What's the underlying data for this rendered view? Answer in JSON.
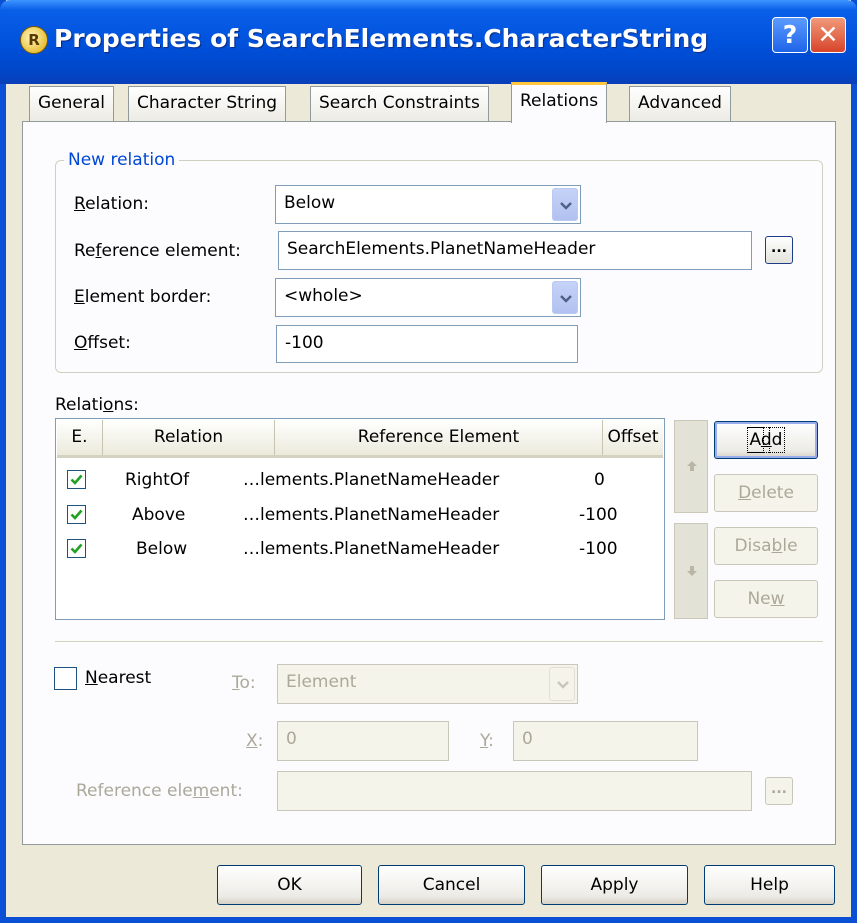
{
  "window": {
    "title": "Properties of SearchElements.CharacterString",
    "help_glyph": "?",
    "close_glyph": "✕",
    "app_icon_glyph": "R"
  },
  "tabs": [
    {
      "label": "General",
      "active": false
    },
    {
      "label": "Character String",
      "active": false
    },
    {
      "label": "Search Constraints",
      "active": false
    },
    {
      "label": "Relations",
      "active": true
    },
    {
      "label": "Advanced",
      "active": false
    }
  ],
  "new_relation": {
    "legend": "New relation",
    "relation_label_pre": "",
    "relation_label_mn": "R",
    "relation_label_post": "elation:",
    "relation_value": "Below",
    "reference_label_pre": "Re",
    "reference_label_mn": "f",
    "reference_label_post": "erence element:",
    "reference_value": "SearchElements.PlanetNameHeader",
    "reference_browse": "...",
    "border_label_pre": "",
    "border_label_mn": "E",
    "border_label_post": "lement border:",
    "border_value": "<whole>",
    "offset_label_pre": "",
    "offset_label_mn": "O",
    "offset_label_post": "ffset:",
    "offset_value": "-100"
  },
  "relations_list": {
    "label_pre": "Relati",
    "label_mn": "o",
    "label_post": "ns:",
    "columns": [
      "E.",
      "Relation",
      "Reference Element",
      "Offset"
    ],
    "rows": [
      {
        "enabled": true,
        "relation": "RightOf",
        "reference": "…lements.PlanetNameHeader",
        "offset": "0"
      },
      {
        "enabled": true,
        "relation": "Above",
        "reference": "…lements.PlanetNameHeader",
        "offset": "-100"
      },
      {
        "enabled": true,
        "relation": "Below",
        "reference": "…lements.PlanetNameHeader",
        "offset": "-100"
      }
    ]
  },
  "list_buttons": {
    "add_pre": "A",
    "add_mn": "d",
    "add_post": "d",
    "delete_pre": "",
    "delete_mn": "D",
    "delete_post": "elete",
    "disable_pre": "Disa",
    "disable_mn": "b",
    "disable_post": "le",
    "new_pre": "Ne",
    "new_mn": "w",
    "new_post": ""
  },
  "nearest": {
    "checkbox_pre": "",
    "checkbox_mn": "N",
    "checkbox_post": "earest",
    "to_pre": "",
    "to_mn": "T",
    "to_post": "o:",
    "to_value": "Element",
    "x_mn": "X",
    "x_post": ":",
    "x_value": "0",
    "y_mn": "Y",
    "y_post": ":",
    "y_value": "0",
    "ref_pre": "Reference ele",
    "ref_mn": "m",
    "ref_post": "ent:",
    "ref_value": "",
    "ref_browse": "..."
  },
  "footer": {
    "ok": "OK",
    "cancel": "Cancel",
    "apply": "Apply",
    "help": "Help"
  }
}
